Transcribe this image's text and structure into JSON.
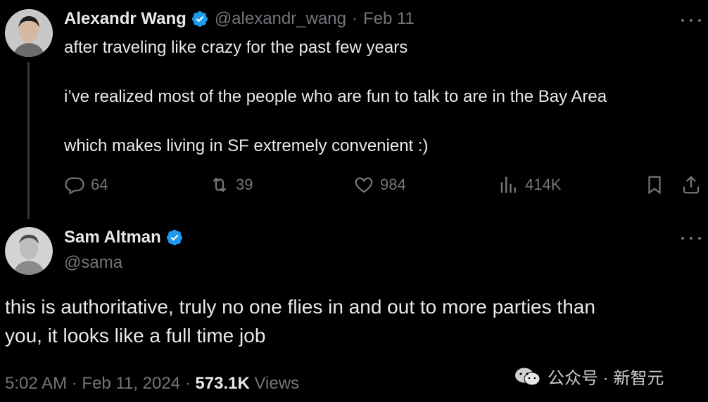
{
  "reply_tweet": {
    "name": "Alexandr Wang",
    "handle": "@alexandr_wang",
    "separator": "·",
    "date": "Feb 11",
    "text": "after traveling like crazy for the past few years\n\ni’ve realized most of the people who are fun to talk to are in the Bay Area\n\nwhich makes living in SF extremely convenient :)",
    "actions": {
      "replies": "64",
      "reposts": "39",
      "likes": "984",
      "views": "414K"
    }
  },
  "main_tweet": {
    "name": "Sam Altman",
    "handle": "@sama",
    "text": "this is authoritative, truly no one flies in and out to more parties than\nyou, it looks like a full time job",
    "time": "5:02 AM",
    "date": "Feb 11, 2024",
    "separator": "·",
    "views_count": "573.1K",
    "views_label": "Views"
  },
  "watermark": {
    "text": "公众号 · 新智元"
  },
  "colors": {
    "background": "#000000",
    "text": "#e7e9ea",
    "muted": "#71767b",
    "verified": "#1d9bf0"
  },
  "icons": [
    "reply-icon",
    "repost-icon",
    "like-icon",
    "views-icon",
    "bookmark-icon",
    "share-icon",
    "verified-badge-icon",
    "more-icon",
    "wechat-icon"
  ]
}
